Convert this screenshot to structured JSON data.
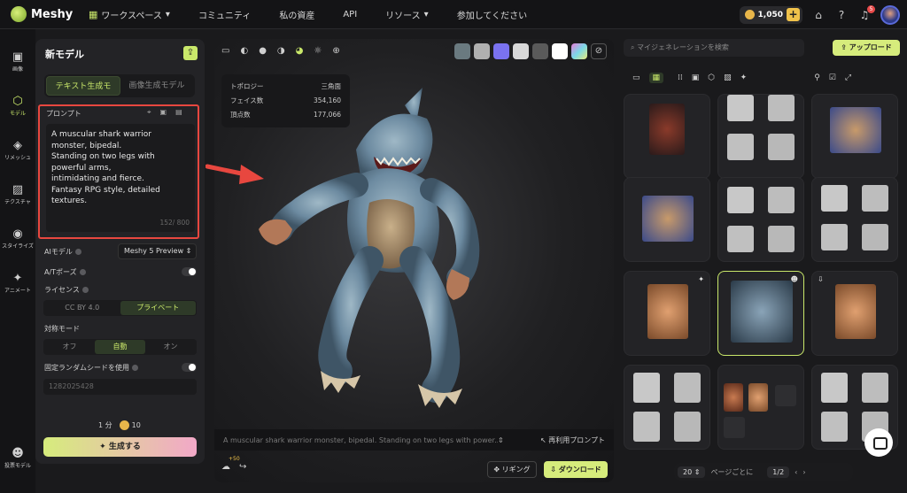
{
  "app": {
    "name": "Meshy"
  },
  "nav": [
    {
      "label": "ワークスペース",
      "has_dropdown": true
    },
    {
      "label": "コミュニティ"
    },
    {
      "label": "私の資産"
    },
    {
      "label": "API"
    },
    {
      "label": "リソース",
      "has_dropdown": true
    },
    {
      "label": "参加してください"
    }
  ],
  "topright": {
    "credits": "1,050",
    "notifications": "5"
  },
  "rail": [
    {
      "label": "画像",
      "icon": "image-icon"
    },
    {
      "label": "モデル",
      "icon": "cube-icon",
      "active": true
    },
    {
      "label": "リメッシュ",
      "icon": "remesh-icon"
    },
    {
      "label": "テクスチャ",
      "icon": "texture-icon"
    },
    {
      "label": "スタイライズ",
      "icon": "stylize-icon"
    },
    {
      "label": "アニメート",
      "icon": "run-icon"
    },
    {
      "label": "投票モデル",
      "icon": "vote-icon"
    }
  ],
  "panel": {
    "title": "新モデル",
    "tabs": [
      "テキスト生成モ",
      "画像生成モデル"
    ],
    "prompt_label": "プロンプト",
    "prompt_text": "A muscular shark warrior monster, bipedal.\nStanding on two legs with powerful arms,\nintimidating and fierce.\nFantasy RPG style, detailed textures.",
    "prompt_count": "152/ 800",
    "ai_model_label": "AIモデル",
    "ai_model_value": "Meshy 5 Preview",
    "atpose_label": "A/Tポーズ",
    "license_label": "ライセンス",
    "license_options": [
      "CC BY 4.0",
      "プライベート"
    ],
    "symmetry_label": "対称モード",
    "symmetry_options": [
      "オフ",
      "自動",
      "オン"
    ],
    "seed_label": "固定ランダムシードを使用",
    "seed_value": "1282025428",
    "time": "1 分",
    "cost": "10",
    "generate": "生成する"
  },
  "viewport": {
    "stats": [
      {
        "k": "トポロジー",
        "v": "三角面"
      },
      {
        "k": "フェイス数",
        "v": "354,160"
      },
      {
        "k": "頂点数",
        "v": "177,066"
      }
    ],
    "bottom_prompt": "A muscular shark warrior monster, bipedal. Standing on two legs with power...",
    "reuse": "再利用プロンプト",
    "rig": "リギング",
    "download": "ダウンロード",
    "credit_bonus": "+50"
  },
  "right": {
    "search_placeholder": "マイジェネレーションを検索",
    "upload": "アップロード",
    "pager_size": "20",
    "pager_label": "ページごとに",
    "pager_page": "1/2"
  }
}
